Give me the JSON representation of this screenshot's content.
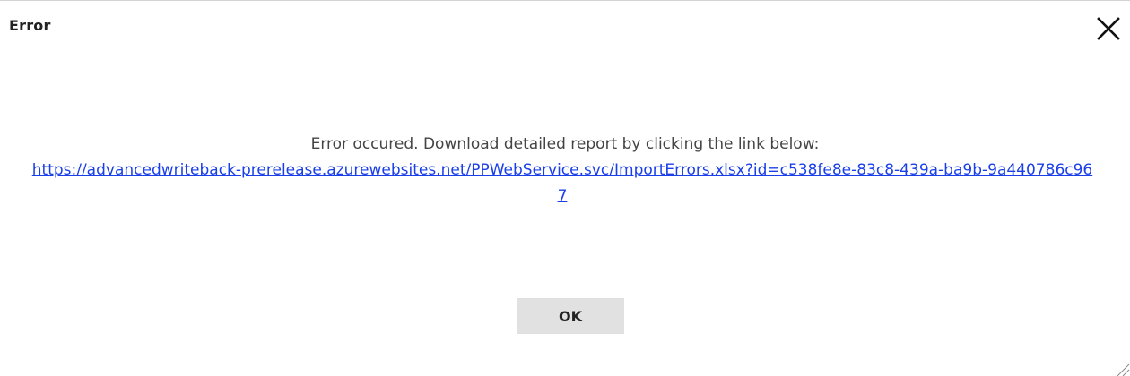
{
  "dialog": {
    "title": "Error",
    "message": "Error occured. Download detailed report by clicking the link below:",
    "link_text": "https://advancedwriteback-prerelease.azurewebsites.net/PPWebService.svc/ImportErrors.xlsx?id=c538fe8e-83c8-439a-ba9b-9a440786c967",
    "ok_label": "OK",
    "close_icon": "close-icon",
    "resize_icon": "resize-grip-icon"
  },
  "colors": {
    "link": "#1a3fe8",
    "button_bg": "#e1e1e1",
    "text": "#444444"
  }
}
